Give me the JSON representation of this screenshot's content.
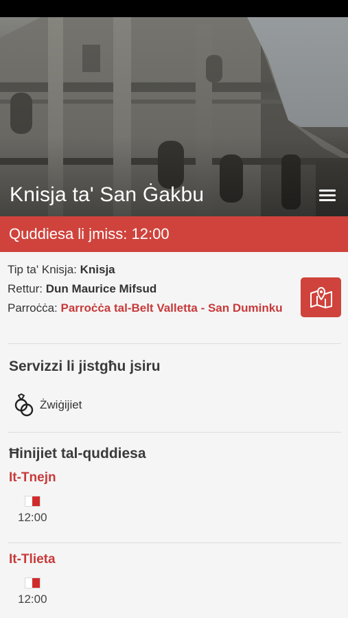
{
  "header": {
    "title": "Knisja ta' San Ġakbu"
  },
  "next_mass": {
    "text": "Quddiesa li jmiss: 12:00"
  },
  "details": {
    "type_label": "Tip ta' Knisja:",
    "type_value": "Knisja",
    "rector_label": "Rettur:",
    "rector_value": "Dun Maurice Mifsud",
    "parish_label": "Parroċċa:",
    "parish_value": "Parroċċa tal-Belt Valletta - San Duminku"
  },
  "services": {
    "title": "Servizzi li jistgħu jsiru",
    "items": [
      {
        "label": "Żwiġijiet",
        "icon": "wedding-rings-icon"
      }
    ]
  },
  "mass_times": {
    "title": "Ħinijiet tal-quddiesa",
    "days": [
      {
        "day": "It-Tnejn",
        "entries": [
          {
            "time": "12:00",
            "language_flag": "malta-flag-icon"
          }
        ]
      },
      {
        "day": "It-Tlieta",
        "entries": [
          {
            "time": "12:00",
            "language_flag": "malta-flag-icon"
          }
        ]
      }
    ]
  },
  "colors": {
    "accent": "#cf433c",
    "accent_text": "#c8393a"
  }
}
